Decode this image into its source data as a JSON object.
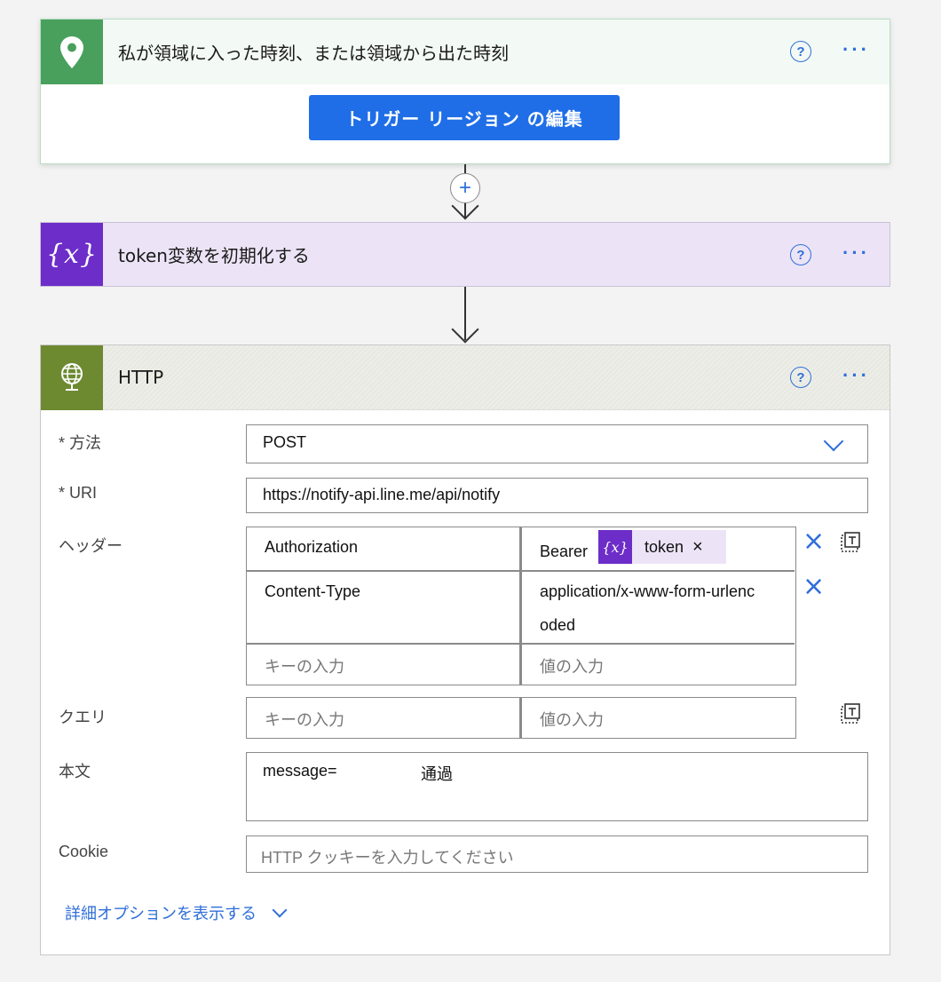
{
  "trigger": {
    "title": "私が領域に入った時刻、または領域から出た時刻",
    "edit_button": "トリガー リージョン の編集",
    "help": "?",
    "more": "···"
  },
  "variable_step": {
    "icon_text": "{x}",
    "title": "token変数を初期化する",
    "help": "?",
    "more": "···"
  },
  "connector": {
    "add": "+"
  },
  "http_step": {
    "title": "HTTP",
    "help": "?",
    "more": "···",
    "method": {
      "label": "* 方法",
      "value": "POST"
    },
    "uri": {
      "label": "* URI",
      "value": "https://notify-api.line.me/api/notify"
    },
    "headers": {
      "label": "ヘッダー",
      "rows": [
        {
          "key": "Authorization",
          "value_prefix": "Bearer",
          "token_chip": {
            "icon": "{x}",
            "text": "token",
            "remove": "×"
          }
        },
        {
          "key": "Content-Type",
          "value_line1": "application/x-www-form-urlenc",
          "value_line2": "oded"
        }
      ],
      "key_placeholder": "キーの入力",
      "value_placeholder": "値の入力",
      "remove": "×"
    },
    "query": {
      "label": "クエリ",
      "key_placeholder": "キーの入力",
      "value_placeholder": "値の入力"
    },
    "body": {
      "label": "本文",
      "value_start": "message=",
      "value_end": "通過"
    },
    "cookie": {
      "label": "Cookie",
      "placeholder": "HTTP クッキーを入力してください"
    },
    "advanced_link": "詳細オプションを表示する"
  },
  "colors": {
    "trigger_accent": "#48a05c",
    "variable_accent": "#6d2dc8",
    "http_accent": "#6d8a31",
    "primary_button": "#1f6ee8",
    "link": "#2f6fd9"
  }
}
